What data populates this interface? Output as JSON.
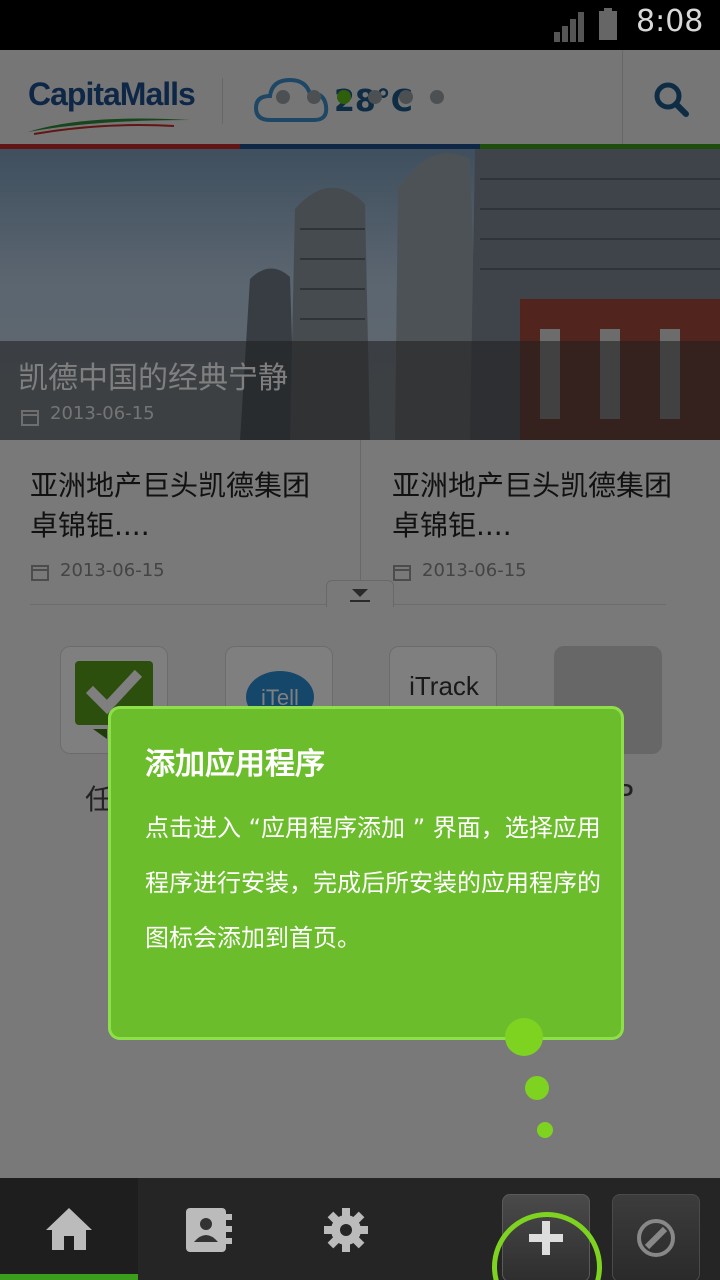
{
  "status_bar": {
    "time": "8:08"
  },
  "header": {
    "logo_text": "CapitaMalls",
    "temperature": "28°C",
    "carousel_active_index": 2,
    "carousel_count": 6
  },
  "hero": {
    "title": "凯德中国的经典宁静",
    "date": "2013-06-15"
  },
  "news": [
    {
      "title": "亚洲地产巨头凯德集团 卓锦钜....",
      "date": "2013-06-15"
    },
    {
      "title": "亚洲地产巨头凯德集团 卓锦钜....",
      "date": "2013-06-15"
    }
  ],
  "apps": [
    {
      "label": "任务",
      "icon": "task-check-icon"
    },
    {
      "label": "iTell",
      "icon": "itell-icon",
      "icon_text": "iTell"
    },
    {
      "label": "iTrack",
      "icon": "itrack-icon",
      "icon_text": "iTrack"
    },
    {
      "label": "APP",
      "icon": "app-placeholder-icon"
    }
  ],
  "tooltip": {
    "title": "添加应用程序",
    "body": "点击进入 “应用程序添加 ” 界面，选择应用程序进行安装，完成后所安装的应用程序的图标会添加到首页。"
  },
  "tabbar": {
    "tabs": [
      "home-icon",
      "contacts-icon",
      "settings-gear-icon",
      "add-icon",
      "edit-icon"
    ],
    "active": "home-icon"
  },
  "colors": {
    "accent_green": "#7ed321",
    "tooltip_bg": "#6cbd2c",
    "brand_blue": "#1f4f8c",
    "tabbar_bg": "#252525"
  }
}
